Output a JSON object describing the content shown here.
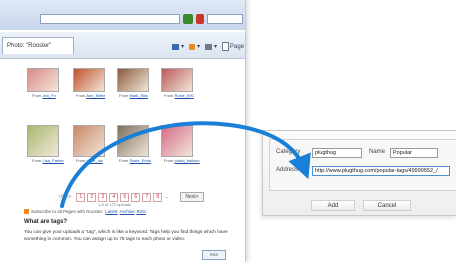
{
  "browser": {
    "address": "",
    "tab_title": "Photo: \"Rooster\"",
    "toolbar": {
      "home": "",
      "feeds": "",
      "print": "",
      "page": "Page"
    }
  },
  "gallery": {
    "photos": [
      {
        "caption_prefix": "From",
        "caption_link": "Jen_Fn",
        "color": "#d98a8a"
      },
      {
        "caption_prefix": "From",
        "caption_link": "Ann_Miller",
        "color": "#c0502a"
      },
      {
        "caption_prefix": "From",
        "caption_link": "Mark_Ellis",
        "color": "#8a5a3a"
      },
      {
        "caption_prefix": "From",
        "caption_link": "Rosie_WG",
        "color": "#b95a5a"
      },
      {
        "caption_prefix": "From",
        "caption_link": "Lisa_Parker",
        "color": "#a8b870"
      },
      {
        "caption_prefix": "From",
        "caption_link": "Lane_Inc",
        "color": "#c9876a"
      },
      {
        "caption_prefix": "From",
        "caption_link": "Susie_Ends",
        "color": "#7d7060"
      },
      {
        "caption_prefix": "From",
        "caption_link": "photo_balloon",
        "color": "#d46a8a"
      }
    ],
    "pager": {
      "prefix": "<Prev",
      "pages": [
        "1",
        "2",
        "3",
        "4",
        "5",
        "6",
        "7",
        "8",
        "..."
      ],
      "next": "Next>"
    },
    "count": "1-8 of 172 uploads",
    "subscribe_text": "Subscribe to all Pages with Rooster:",
    "subscribe_links": [
      "Latest",
      "Archive",
      "RSS"
    ],
    "tags_heading": "What are tags?",
    "tags_text": "You can give your uploads a \"tag\", which is like a keyword. Tags help you find things which have something in common. You can assign up to 75 tags to each photo or video.",
    "badge": "RSS"
  },
  "dialog": {
    "category_label": "Category",
    "category_value": "plugthug",
    "name_label": "Name",
    "name_value": "Popular",
    "address_label": "Address",
    "address_value": "http://www.plugthug.com/popular-tags/49999552_/",
    "add_label": "Add",
    "cancel_label": "Cancel"
  },
  "arrow_color": "#1a7fd6"
}
